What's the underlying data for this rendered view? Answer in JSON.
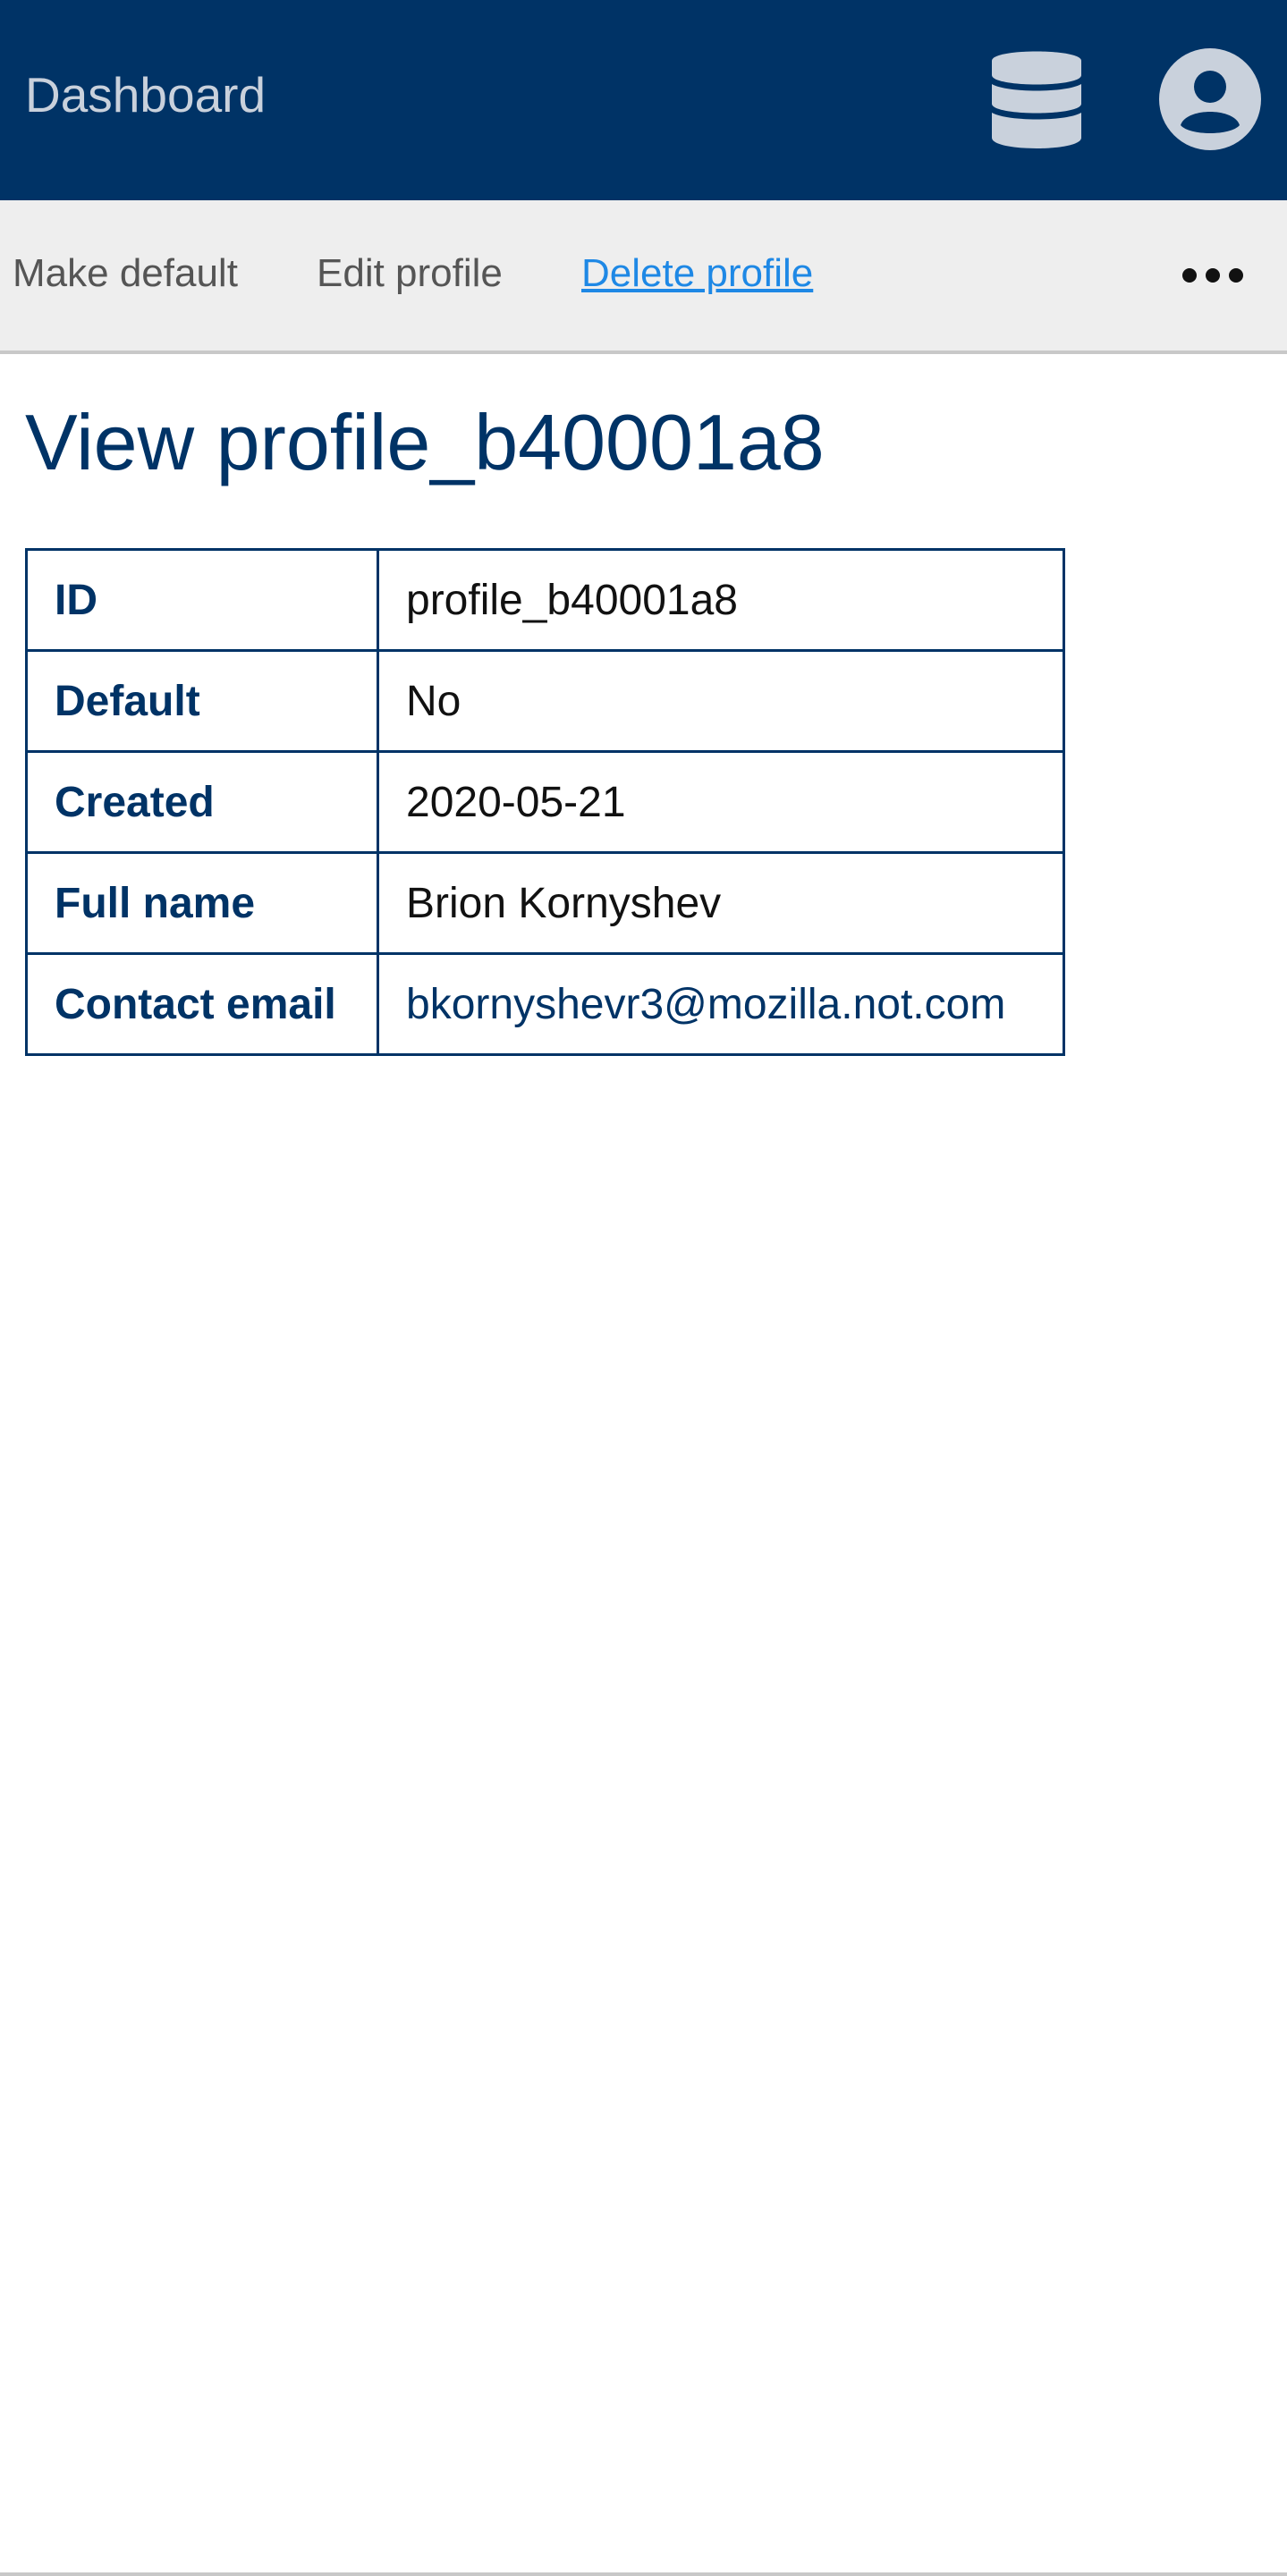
{
  "header": {
    "brand": "Dashboard",
    "icons": {
      "database": "database-icon",
      "user": "user-circle-icon"
    },
    "colors": {
      "background": "#003366",
      "icon": "#c9d1dc"
    }
  },
  "subnav": {
    "items": [
      {
        "label": "Make default"
      },
      {
        "label": "Edit profile"
      },
      {
        "label": "Delete profile"
      }
    ],
    "more_icon": "more-horizontal-icon"
  },
  "main": {
    "title": "View profile_b40001a8",
    "details": [
      {
        "label": "ID",
        "value": "profile_b40001a8"
      },
      {
        "label": "Default",
        "value": "No"
      },
      {
        "label": "Created",
        "value": "2020-05-21"
      },
      {
        "label": "Full name",
        "value": "Brion Kornyshev"
      },
      {
        "label": "Contact email",
        "value": "bkornyshevr3@mozilla.not.com"
      }
    ]
  }
}
